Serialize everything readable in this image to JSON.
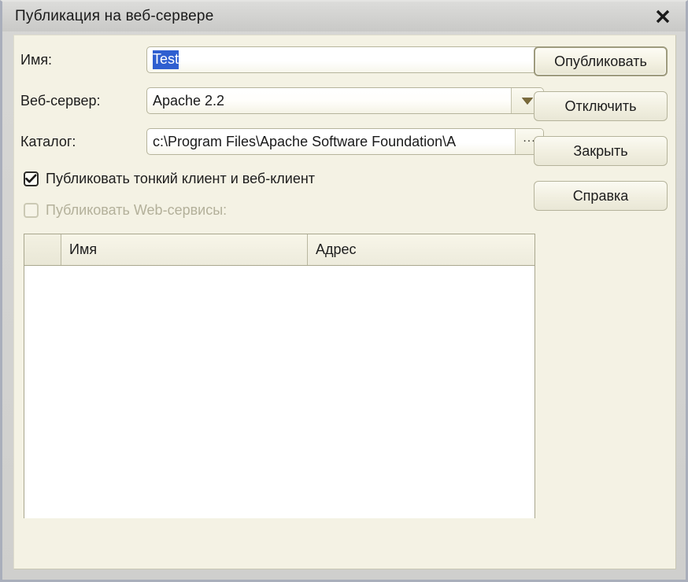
{
  "window": {
    "title": "Публикация на веб-сервере",
    "close_icon": "close-icon"
  },
  "form": {
    "name": {
      "label": "Имя:",
      "value": "Test",
      "selected": true
    },
    "web_server": {
      "label": "Веб-сервер:",
      "value": "Apache 2.2",
      "dropdown_icon": "chevron-down-icon"
    },
    "catalog": {
      "label": "Каталог:",
      "value": "c:\\Program Files\\Apache Software Foundation\\A",
      "browse_label": "..."
    }
  },
  "checkboxes": {
    "thin_client": {
      "label": "Публиковать тонкий клиент и веб-клиент",
      "checked": true,
      "check_glyph": "✓"
    },
    "web_services": {
      "label": "Публиковать Web-сервисы:",
      "checked": false,
      "disabled": true
    }
  },
  "table": {
    "columns": [
      "",
      "Имя",
      "Адрес"
    ],
    "rows": []
  },
  "buttons": {
    "publish": "Опубликовать",
    "disconnect": "Отключить",
    "close": "Закрыть",
    "help": "Справка"
  },
  "colors": {
    "dialog_background": "#f4f2e4",
    "titlebar": "#d7d7d5",
    "selection": "#2f5fd0",
    "frame": "#a9aebb",
    "border": "#b6b49c"
  }
}
